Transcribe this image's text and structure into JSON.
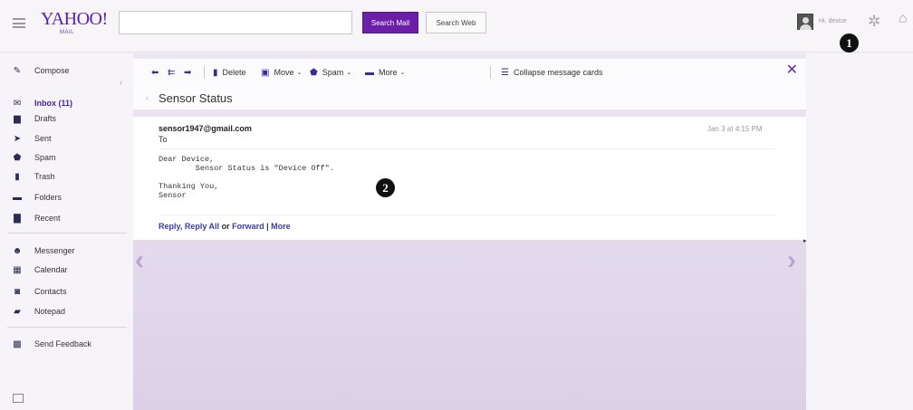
{
  "header": {
    "logo": "YAHOO!",
    "logo_sub": "MAIL",
    "search_mail_label": "Search Mail",
    "search_web_label": "Search Web",
    "greeting": "Hi, device"
  },
  "markers": [
    "1",
    "2"
  ],
  "sidebar": {
    "compose": "Compose",
    "items": [
      {
        "label": "Inbox (11)",
        "icon": "inbox-icon"
      },
      {
        "label": "Drafts",
        "icon": "drafts-icon"
      },
      {
        "label": "Sent",
        "icon": "sent-icon"
      },
      {
        "label": "Spam",
        "icon": "spam-icon"
      },
      {
        "label": "Trash",
        "icon": "trash-icon"
      },
      {
        "label": "Folders",
        "icon": "folder-icon"
      },
      {
        "label": "Recent",
        "icon": "recent-icon"
      }
    ],
    "apps": [
      {
        "label": "Messenger",
        "icon": "messenger-icon"
      },
      {
        "label": "Calendar",
        "icon": "calendar-icon"
      },
      {
        "label": "Contacts",
        "icon": "contacts-icon"
      },
      {
        "label": "Notepad",
        "icon": "notepad-icon"
      }
    ],
    "feedback": "Send Feedback"
  },
  "toolbar": {
    "delete": "Delete",
    "move": "Move",
    "spam": "Spam",
    "more": "More",
    "collapse": "Collapse message cards"
  },
  "message": {
    "subject": "Sensor Status",
    "sender": "sensor1947@gmail.com",
    "to": "To",
    "date": "Jan 3 at 4:15 PM",
    "body_line1": "Dear Device,",
    "body_line2": "        Sensor Status is \"Device Off\".",
    "body_line3": "Thanking You,",
    "body_line4": "Sensor",
    "reply": "Reply",
    "reply_all": "Reply All",
    "or": "or",
    "forward": "Forward",
    "more": "More"
  },
  "colors": {
    "brand": "#5a1fb0",
    "accent": "#6b1ea8"
  }
}
